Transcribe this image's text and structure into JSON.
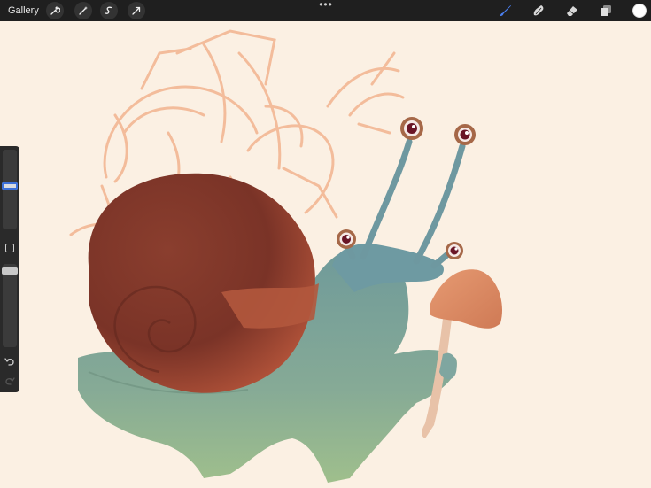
{
  "toolbar": {
    "gallery_label": "Gallery",
    "actions_icons": [
      "wrench-icon",
      "magic-wand-icon",
      "selection-icon",
      "transform-arrow-icon"
    ],
    "more_label": "•••",
    "right_tools": [
      "brush-icon",
      "smudge-icon",
      "eraser-icon",
      "layers-icon"
    ],
    "active_tool": "brush-icon",
    "current_color": "#ffffff",
    "accent_color": "#3b6fd8"
  },
  "sidebar": {
    "brush_size_level": 0.45,
    "opacity_level": 0.05,
    "controls": [
      "modifier-square-icon",
      "undo-icon",
      "redo-icon"
    ]
  },
  "canvas": {
    "background_color": "#fbf0e3",
    "sketch_color": "#f2b48f"
  }
}
